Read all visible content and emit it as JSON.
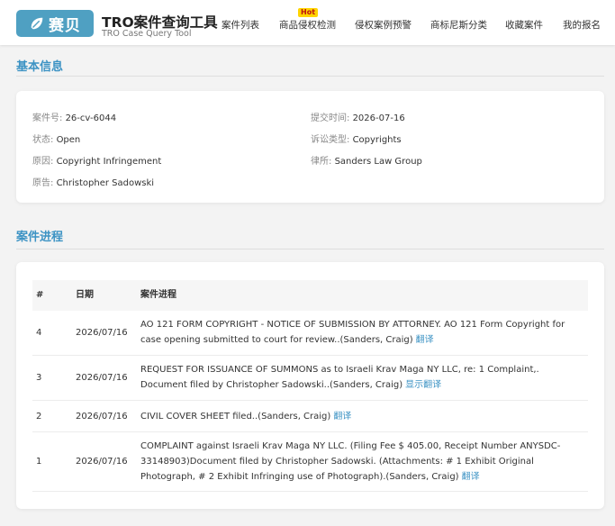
{
  "header": {
    "logo_text": "赛贝",
    "title": "TRO案件查询工具",
    "subtitle": "TRO Case Query Tool",
    "hot_badge": "Hot",
    "nav": [
      {
        "label": "案件列表"
      },
      {
        "label": "商品侵权检测"
      },
      {
        "label": "侵权案例预警"
      },
      {
        "label": "商标尼斯分类"
      },
      {
        "label": "收藏案件"
      },
      {
        "label": "我的报名"
      }
    ]
  },
  "basic_info": {
    "heading": "基本信息",
    "case_no": {
      "label": "案件号:",
      "value": "26-cv-6044"
    },
    "submit_time": {
      "label": "提交时间:",
      "value": "2026-07-16"
    },
    "status": {
      "label": "状态:",
      "value": "Open"
    },
    "case_type": {
      "label": "诉讼类型:",
      "value": "Copyrights"
    },
    "cause": {
      "label": "原因:",
      "value": "Copyright Infringement"
    },
    "lawyer": {
      "label": "律所:",
      "value": "Sanders Law Group"
    },
    "plaintiff": {
      "label": "原告:",
      "value": "Christopher Sadowski"
    }
  },
  "progress": {
    "heading": "案件进程",
    "columns": [
      "#",
      "日期",
      "案件进程"
    ],
    "rows": [
      {
        "num": "4",
        "date": "2026/07/16",
        "desc": "AO 121 FORM COPYRIGHT - NOTICE OF SUBMISSION BY ATTORNEY. AO 121 Form Copyright for case opening submitted to court for review..(Sanders, Craig)",
        "action": "翻译"
      },
      {
        "num": "3",
        "date": "2026/07/16",
        "desc": "REQUEST FOR ISSUANCE OF SUMMONS as to Israeli Krav Maga NY LLC, re: 1 Complaint,. Document filed by Christopher Sadowski..(Sanders, Craig)",
        "action": "显示翻译"
      },
      {
        "num": "2",
        "date": "2026/07/16",
        "desc": "CIVIL COVER SHEET filed..(Sanders, Craig)",
        "action": "翻译"
      },
      {
        "num": "1",
        "date": "2026/07/16",
        "desc": "COMPLAINT against Israeli Krav Maga NY LLC. (Filing Fee $ 405.00, Receipt Number ANYSDC-33148903)Document filed by Christopher Sadowski. (Attachments: # 1 Exhibit Original Photograph, # 2 Exhibit Infringing use of Photograph).(Sanders, Craig)",
        "action": "翻译"
      }
    ]
  }
}
